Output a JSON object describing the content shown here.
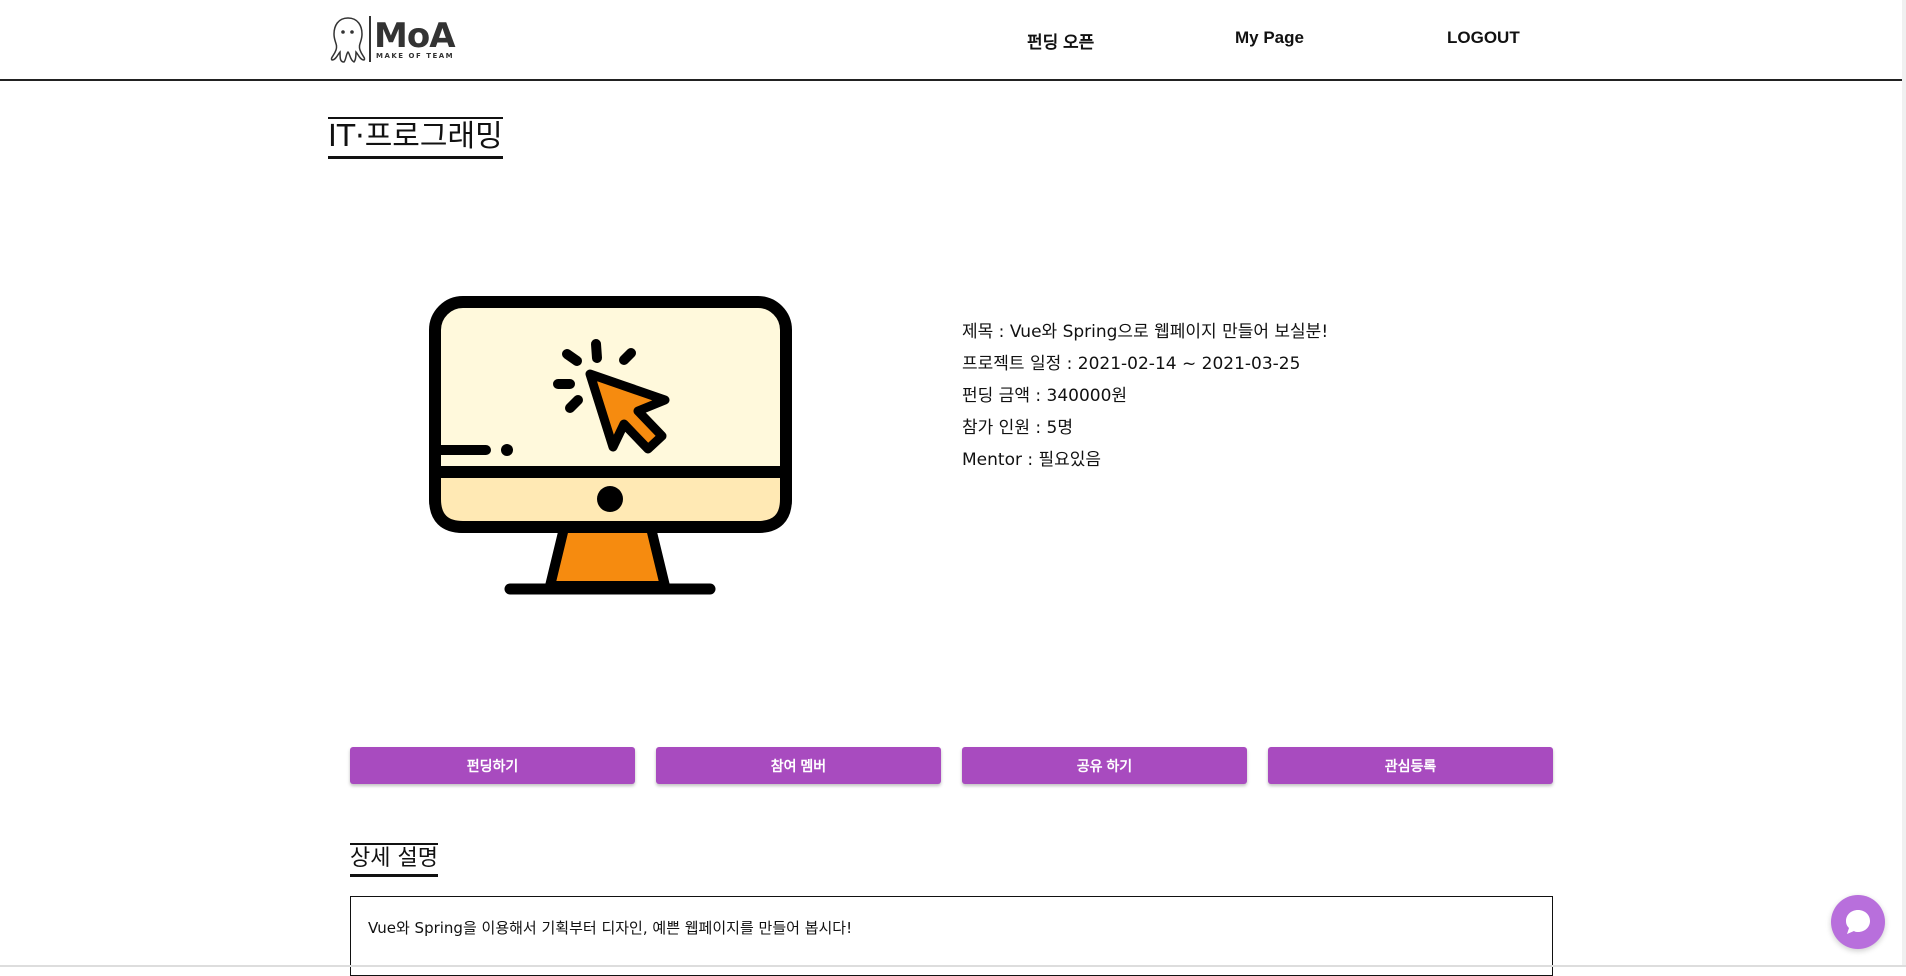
{
  "header": {
    "logo_text": "MoA",
    "logo_subtext": "MAKE OF TEAM",
    "nav": {
      "funding_open": "펀딩 오픈",
      "my_page": "My Page",
      "logout": "LOGOUT"
    }
  },
  "category": {
    "title": "IT·프로그래밍"
  },
  "project": {
    "title_line": "제목 : Vue와 Spring으로 웹페이지 만들어 보실분!",
    "schedule_line": "프로젝트 일정 : 2021-02-14 ~ 2021-03-25",
    "amount_line": "펀딩 금액 : 340000원",
    "members_line": "참가 인원 : 5명",
    "mentor_line": "Mentor : 필요있음",
    "image_icon": "computer-monitor-click-icon"
  },
  "actions": {
    "fund": "펀딩하기",
    "members": "참여 멤버",
    "share": "공유 하기",
    "favorite": "관심등록"
  },
  "detail": {
    "title": "상세 설명",
    "text": "Vue와 Spring을 이용해서 기획부터 디자인, 예쁜 웹페이지를 만들어 봅시다!"
  },
  "chat": {
    "icon": "chat-bubble-icon"
  },
  "colors": {
    "accent": "#a84bbf",
    "chat": "#b86fdc",
    "monitor_screen": "#fff9dc",
    "monitor_stand": "#f68b0f"
  }
}
